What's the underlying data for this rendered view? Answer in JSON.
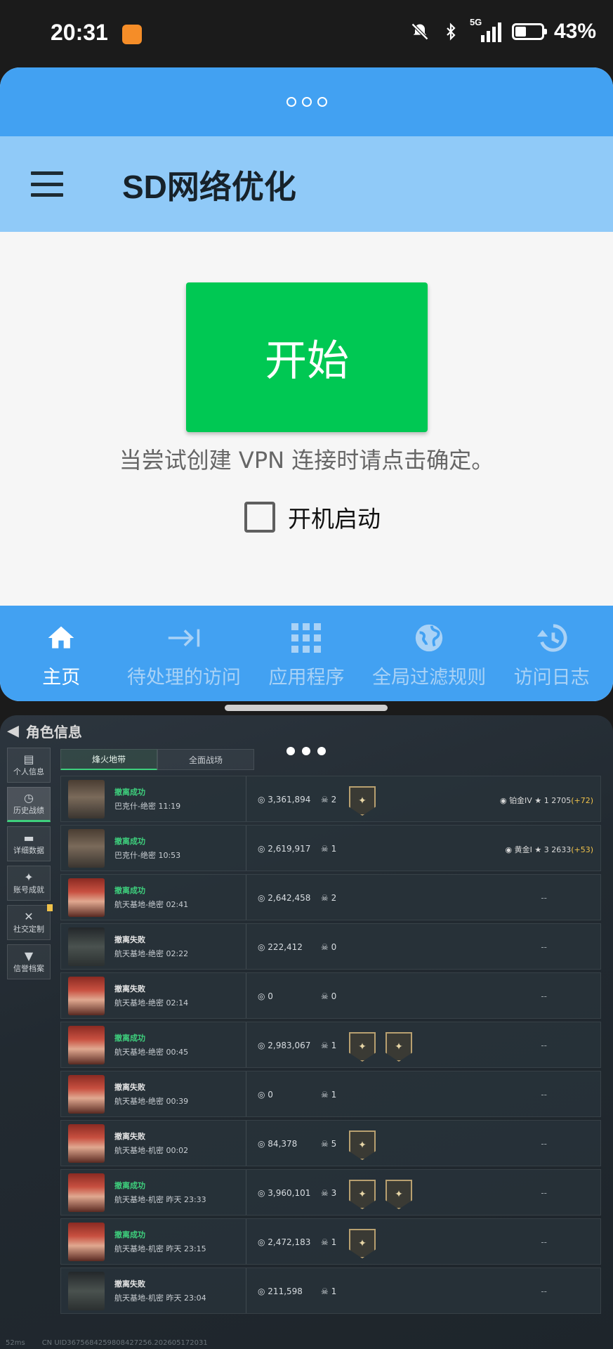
{
  "status_bar": {
    "time": "20:31",
    "network": "5G",
    "battery_percent_text": "43%",
    "battery_level": 0.43,
    "icons": [
      "bell-off-icon",
      "bluetooth-icon",
      "signal-icon",
      "battery-icon"
    ]
  },
  "vpn_app": {
    "title": "SD网络优化",
    "start_button": "开始",
    "hint": "当尝试创建 VPN 连接时请点击确定。",
    "autostart_label": "开机启动",
    "autostart_checked": false,
    "nav": [
      {
        "label": "主页",
        "icon": "home-icon",
        "active": true
      },
      {
        "label": "待处理的访问",
        "icon": "arrow-to-line-icon",
        "active": false
      },
      {
        "label": "应用程序",
        "icon": "grid-icon",
        "active": false
      },
      {
        "label": "全局过滤规则",
        "icon": "globe-icon",
        "active": false
      },
      {
        "label": "访问日志",
        "icon": "history-icon",
        "active": false
      }
    ],
    "colors": {
      "header_blue": "#42a1f2",
      "toolbar_light_blue": "#90caf8",
      "start_green": "#00c853"
    }
  },
  "game": {
    "title": "角色信息",
    "sidebar": [
      {
        "label": "个人信息",
        "icon": "bar-chart-icon",
        "active": false
      },
      {
        "label": "历史战绩",
        "icon": "clock-icon",
        "active": true
      },
      {
        "label": "详细数据",
        "icon": "folder-icon",
        "active": false
      },
      {
        "label": "账号成就",
        "icon": "medal-icon",
        "active": false
      },
      {
        "label": "社交定制",
        "icon": "tools-icon",
        "active": false
      },
      {
        "label": "信誉档案",
        "icon": "shield-icon",
        "active": false
      }
    ],
    "tabs": [
      {
        "label": "烽火地带",
        "active": true
      },
      {
        "label": "全面战场",
        "active": false
      }
    ],
    "matches": [
      {
        "status": "撤离成功",
        "result": "ok",
        "map": "巴克什-绝密 11:19",
        "money": "3,361,894",
        "kills": "2",
        "medals": 1,
        "rank": "铂金IV",
        "stars": "1",
        "score": "2705",
        "delta": "(+72)",
        "avatar": "male"
      },
      {
        "status": "撤离成功",
        "result": "ok",
        "map": "巴克什-绝密 10:53",
        "money": "2,619,917",
        "kills": "1",
        "medals": 0,
        "rank": "黄金I",
        "stars": "3",
        "score": "2633",
        "delta": "(+53)",
        "avatar": "male"
      },
      {
        "status": "撤离成功",
        "result": "ok",
        "map": "航天基地-绝密 02:41",
        "money": "2,642,458",
        "kills": "2",
        "medals": 0,
        "dash": "--",
        "avatar": "female"
      },
      {
        "status": "撤离失败",
        "result": "fail",
        "map": "航天基地-绝密 02:22",
        "money": "222,412",
        "kills": "0",
        "medals": 0,
        "dash": "--",
        "avatar": "dark"
      },
      {
        "status": "撤离失败",
        "result": "fail",
        "map": "航天基地-绝密 02:14",
        "money": "0",
        "kills": "0",
        "medals": 0,
        "dash": "--",
        "avatar": "female"
      },
      {
        "status": "撤离成功",
        "result": "ok",
        "map": "航天基地-绝密 00:45",
        "money": "2,983,067",
        "kills": "1",
        "medals": 2,
        "dash": "--",
        "avatar": "female"
      },
      {
        "status": "撤离失败",
        "result": "fail",
        "map": "航天基地-绝密 00:39",
        "money": "0",
        "kills": "1",
        "medals": 0,
        "dash": "--",
        "avatar": "female"
      },
      {
        "status": "撤离失败",
        "result": "fail",
        "map": "航天基地-机密 00:02",
        "money": "84,378",
        "kills": "5",
        "medals": 1,
        "dash": "--",
        "avatar": "female"
      },
      {
        "status": "撤离成功",
        "result": "ok",
        "map": "航天基地-机密 昨天 23:33",
        "money": "3,960,101",
        "kills": "3",
        "medals": 2,
        "dash": "--",
        "avatar": "female"
      },
      {
        "status": "撤离成功",
        "result": "ok",
        "map": "航天基地-机密 昨天 23:15",
        "money": "2,472,183",
        "kills": "1",
        "medals": 1,
        "dash": "--",
        "avatar": "female"
      },
      {
        "status": "撤离失败",
        "result": "fail",
        "map": "航天基地-机密 昨天 23:04",
        "money": "211,598",
        "kills": "1",
        "medals": 0,
        "dash": "--",
        "avatar": "dark"
      }
    ],
    "footer": {
      "ping": "52ms",
      "uid": "CN UID3675684259808427256.202605172031"
    }
  }
}
